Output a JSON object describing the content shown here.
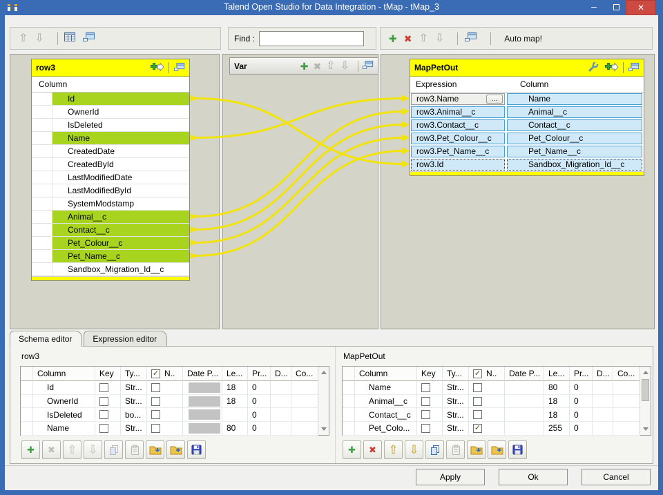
{
  "window": {
    "title": "Talend Open Studio for Data Integration - tMap - tMap_3"
  },
  "top_toolbar_right": {
    "auto_map": "Auto map!"
  },
  "find": {
    "label": "Find :",
    "value": ""
  },
  "var_panel": {
    "title": "Var"
  },
  "input_table": {
    "title": "row3",
    "column_header": "Column",
    "rows": [
      {
        "name": "Id",
        "highlighted": true
      },
      {
        "name": "OwnerId",
        "highlighted": false
      },
      {
        "name": "IsDeleted",
        "highlighted": false
      },
      {
        "name": "Name",
        "highlighted": true
      },
      {
        "name": "CreatedDate",
        "highlighted": false
      },
      {
        "name": "CreatedById",
        "highlighted": false
      },
      {
        "name": "LastModifiedDate",
        "highlighted": false
      },
      {
        "name": "LastModifiedById",
        "highlighted": false
      },
      {
        "name": "SystemModstamp",
        "highlighted": false
      },
      {
        "name": "Animal__c",
        "highlighted": true
      },
      {
        "name": "Contact__c",
        "highlighted": true
      },
      {
        "name": "Pet_Colour__c",
        "highlighted": true
      },
      {
        "name": "Pet_Name__c",
        "highlighted": true
      },
      {
        "name": "Sandbox_Migration_Id__c",
        "highlighted": false
      }
    ]
  },
  "output_table": {
    "title": "MapPetOut",
    "headers": {
      "expression": "Expression",
      "column": "Column"
    },
    "browse_label": "...",
    "rows": [
      {
        "expression": "row3.Name",
        "column": "Name",
        "editing": true
      },
      {
        "expression": "row3.Animal__c",
        "column": "Animal__c"
      },
      {
        "expression": "row3.Contact__c",
        "column": "Contact__c"
      },
      {
        "expression": "row3.Pet_Colour__c",
        "column": "Pet_Colour__c"
      },
      {
        "expression": "row3.Pet_Name__c",
        "column": "Pet_Name__c"
      },
      {
        "expression": "row3.Id",
        "column": "Sandbox_Migration_Id__c",
        "focused": true
      }
    ]
  },
  "mappings": [
    {
      "from": "Id",
      "to": "Sandbox_Migration_Id__c"
    },
    {
      "from": "Name",
      "to": "Name"
    },
    {
      "from": "Animal__c",
      "to": "Animal__c"
    },
    {
      "from": "Contact__c",
      "to": "Contact__c"
    },
    {
      "from": "Pet_Colour__c",
      "to": "Pet_Colour__c"
    },
    {
      "from": "Pet_Name__c",
      "to": "Pet_Name__c"
    }
  ],
  "schema_editor": {
    "tabs": [
      {
        "label": "Schema editor",
        "active": true
      },
      {
        "label": "Expression editor",
        "active": false
      }
    ],
    "left": {
      "title": "row3",
      "headers": [
        "Column",
        "Key",
        "Ty...",
        "N..",
        "Date P...",
        "Le...",
        "Pr...",
        "D...",
        "Co..."
      ],
      "header_checkbox_checked": true,
      "date_cells_disabled": true,
      "rows": [
        {
          "column": "Id",
          "key": false,
          "type": "Str...",
          "nullable": false,
          "date": "",
          "length": "18",
          "precision": "0",
          "default": "",
          "comment": ""
        },
        {
          "column": "OwnerId",
          "key": false,
          "type": "Str...",
          "nullable": false,
          "date": "",
          "length": "18",
          "precision": "0",
          "default": "",
          "comment": ""
        },
        {
          "column": "IsDeleted",
          "key": false,
          "type": "bo...",
          "nullable": false,
          "date": "",
          "length": "",
          "precision": "0",
          "default": "",
          "comment": ""
        },
        {
          "column": "Name",
          "key": false,
          "type": "Str...",
          "nullable": false,
          "date": "",
          "length": "80",
          "precision": "0",
          "default": "",
          "comment": ""
        }
      ],
      "scrollbar_thumb": false
    },
    "right": {
      "title": "MapPetOut",
      "headers": [
        "Column",
        "Key",
        "Ty...",
        "N..",
        "Date P...",
        "Le...",
        "Pr...",
        "D...",
        "Co..."
      ],
      "header_checkbox_checked": true,
      "date_cells_disabled": false,
      "rows": [
        {
          "column": "Name",
          "key": false,
          "type": "Str...",
          "nullable": false,
          "date": "",
          "length": "80",
          "precision": "0",
          "default": "",
          "comment": ""
        },
        {
          "column": "Animal__c",
          "key": false,
          "type": "Str...",
          "nullable": false,
          "date": "",
          "length": "18",
          "precision": "0",
          "default": "",
          "comment": ""
        },
        {
          "column": "Contact__c",
          "key": false,
          "type": "Str...",
          "nullable": false,
          "date": "",
          "length": "18",
          "precision": "0",
          "default": "",
          "comment": ""
        },
        {
          "column": "Pet_Colo...",
          "key": false,
          "type": "Str...",
          "nullable": true,
          "date": "",
          "length": "255",
          "precision": "0",
          "default": "",
          "comment": ""
        }
      ],
      "scrollbar_thumb": true
    }
  },
  "footer_buttons": {
    "apply": "Apply",
    "ok": "Ok",
    "cancel": "Cancel"
  },
  "colors": {
    "titlebar": "#3a6bb5",
    "table_header_yellow": "#ffff00",
    "highlight_green": "#a8d420",
    "mapping_line_yellow": "#f2e30b",
    "output_cell_blue": "#cfe9f8",
    "output_cell_border": "#47a0d3",
    "panel_background": "#d4d4c8"
  }
}
